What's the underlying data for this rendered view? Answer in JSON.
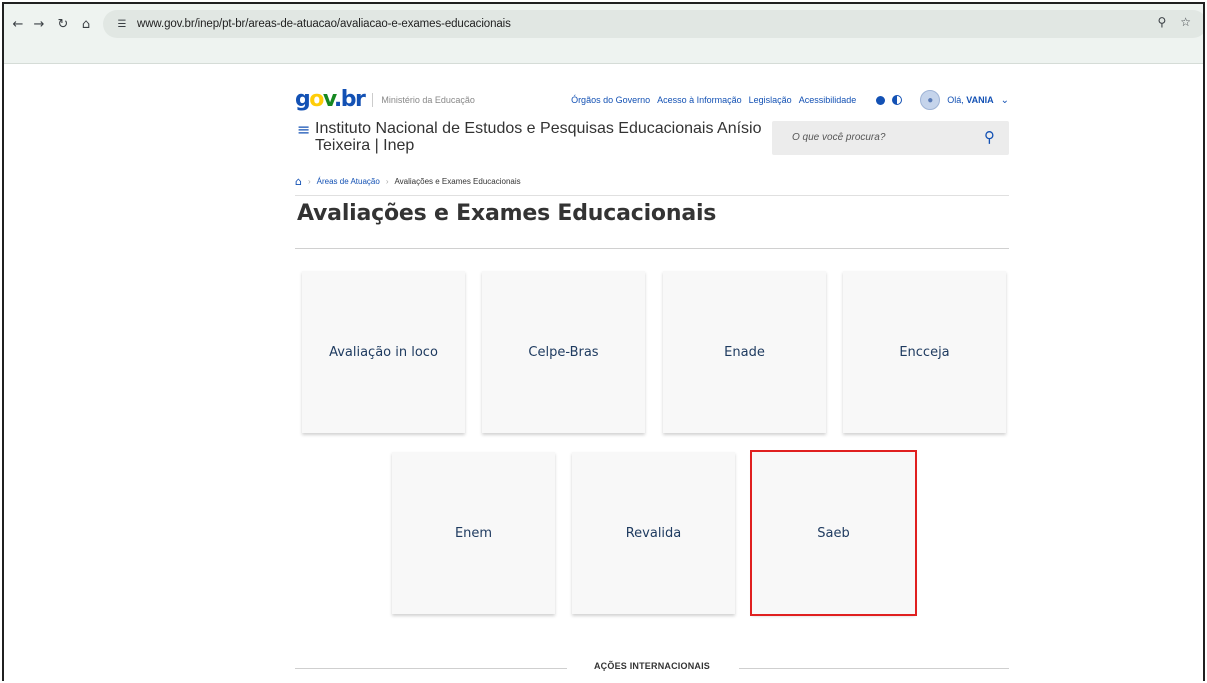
{
  "browser": {
    "url": "www.gov.br/inep/pt-br/areas-de-atuacao/avaliacao-e-exames-educacionais",
    "icons": [
      "back-icon",
      "forward-icon",
      "reload-icon",
      "home-icon",
      "site-info-icon",
      "zoom-icon",
      "bookmark-star-icon"
    ]
  },
  "govbar": {
    "logo": "gov.br",
    "ministry": "Ministério da Educação",
    "links": [
      "Órgãos do Governo",
      "Acesso à Informação",
      "Legislação",
      "Acessibilidade"
    ],
    "greeting": "Olá,",
    "username": "VANIA"
  },
  "header": {
    "site_title": "Instituto Nacional de Estudos e Pesquisas Educacionais Anísio Teixeira | Inep",
    "search_placeholder": "O que você procura?"
  },
  "breadcrumb": {
    "items": [
      "Áreas de Atuação",
      "Avaliações e Exames Educacionais"
    ]
  },
  "main": {
    "title": "Avaliações e Exames Educacionais",
    "cards_row1": [
      "Avaliação in loco",
      "Celpe-Bras",
      "Enade",
      "Encceja"
    ],
    "cards_row2": [
      "Enem",
      "Revalida",
      "Saeb"
    ],
    "highlighted_card": "Saeb",
    "section_label": "AÇÕES INTERNACIONAIS"
  },
  "colors": {
    "brand_blue": "#1351b4",
    "highlight_red": "#e02020",
    "card_bg": "#f8f8f8"
  }
}
